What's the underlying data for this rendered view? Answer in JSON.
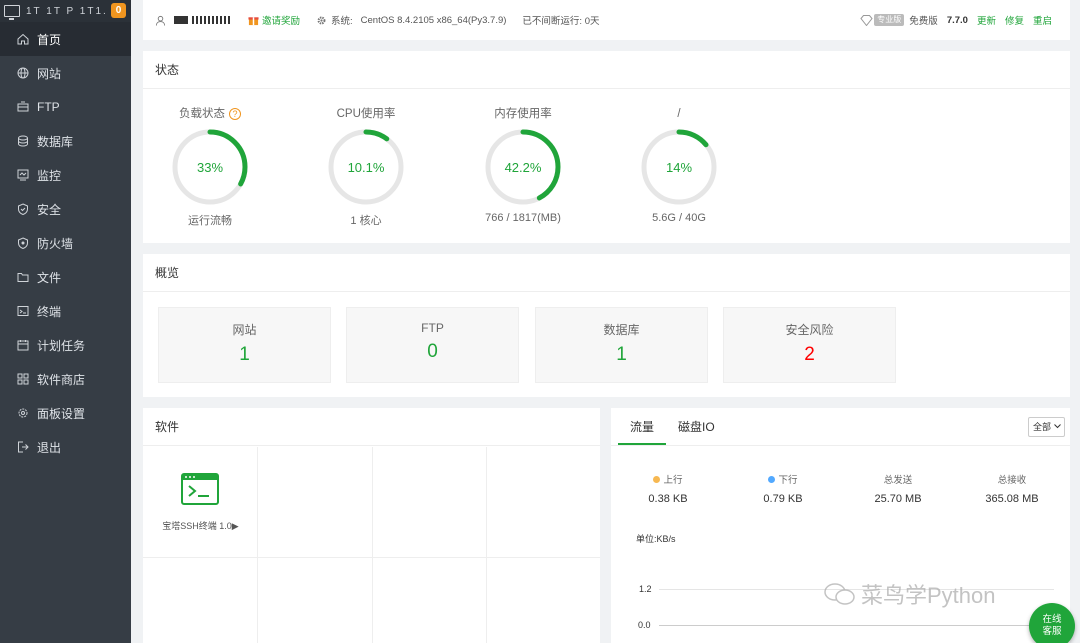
{
  "sidebar": {
    "server_name": "1T  1T  P  1T1. 11",
    "badge": "0",
    "items": [
      {
        "label": "首页",
        "icon": "home-icon",
        "active": true
      },
      {
        "label": "网站",
        "icon": "globe-icon"
      },
      {
        "label": "FTP",
        "icon": "ftp-icon"
      },
      {
        "label": "数据库",
        "icon": "database-icon"
      },
      {
        "label": "监控",
        "icon": "monitor-icon"
      },
      {
        "label": "安全",
        "icon": "shield-icon"
      },
      {
        "label": "防火墙",
        "icon": "firewall-icon"
      },
      {
        "label": "文件",
        "icon": "folder-icon"
      },
      {
        "label": "终端",
        "icon": "terminal-icon"
      },
      {
        "label": "计划任务",
        "icon": "calendar-icon"
      },
      {
        "label": "软件商店",
        "icon": "grid-icon"
      },
      {
        "label": "面板设置",
        "icon": "settings-icon"
      },
      {
        "label": "退出",
        "icon": "logout-icon"
      }
    ]
  },
  "topbar": {
    "invite": "邀请奖励",
    "system_label": "系统:",
    "system_value": "CentOS 8.4.2105 x86_64(Py3.7.9)",
    "uptime": "已不间断运行: 0天",
    "pro_tag": "专业版",
    "edition": "免费版",
    "version": "7.7.0",
    "update": "更新",
    "repair": "修复",
    "restart": "重启"
  },
  "status": {
    "title": "状态",
    "gauges": [
      {
        "label": "负载状态",
        "value": "33%",
        "percent": 33,
        "sub": "运行流畅"
      },
      {
        "label": "CPU使用率",
        "value": "10.1%",
        "percent": 10.1,
        "sub": "1 核心"
      },
      {
        "label": "内存使用率",
        "value": "42.2%",
        "percent": 42.2,
        "sub": "766 / 1817(MB)"
      },
      {
        "label": "/",
        "value": "14%",
        "percent": 14,
        "sub": "5.6G / 40G"
      }
    ]
  },
  "overview": {
    "title": "概览",
    "cards": [
      {
        "label": "网站",
        "value": "1"
      },
      {
        "label": "FTP",
        "value": "0"
      },
      {
        "label": "数据库",
        "value": "1"
      },
      {
        "label": "安全风险",
        "value": "2"
      }
    ]
  },
  "software": {
    "title": "软件",
    "items": [
      {
        "label": "宝塔SSH终端 1.0▶",
        "icon": "terminal-window-icon"
      }
    ]
  },
  "traffic": {
    "tabs": [
      "流量",
      "磁盘IO"
    ],
    "select": "全部",
    "stats": [
      {
        "label": "上行",
        "value": "0.38 KB",
        "dot": "#f7b851"
      },
      {
        "label": "下行",
        "value": "0.79 KB",
        "dot": "#52a9ff"
      },
      {
        "label": "总发送",
        "value": "25.70 MB"
      },
      {
        "label": "总接收",
        "value": "365.08 MB"
      }
    ],
    "unit": "单位:KB/s",
    "ticks": [
      "1.2",
      "0.0"
    ]
  },
  "online_service": "在线\n客服",
  "watermark": "菜鸟学Python",
  "colors": {
    "accent": "#20a53a",
    "danger": "#ff0000",
    "sidebar": "#363d45"
  }
}
